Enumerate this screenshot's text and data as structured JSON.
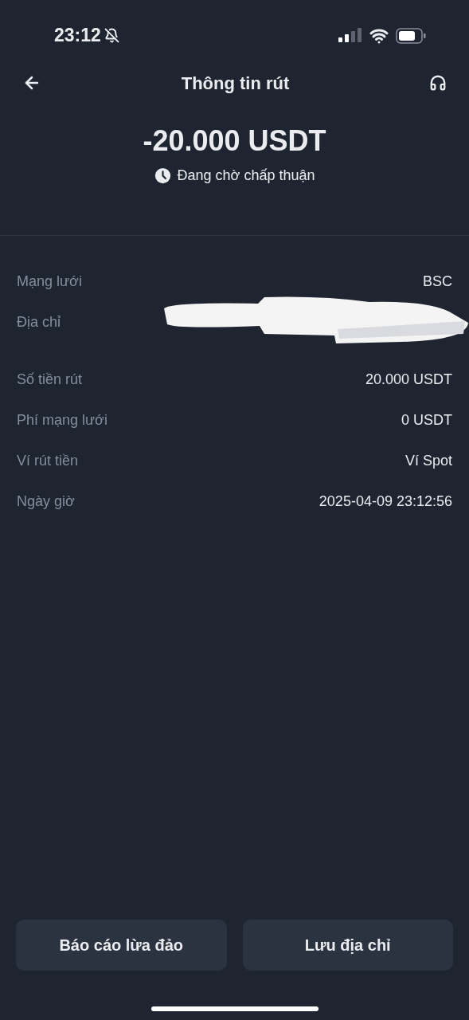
{
  "status_bar": {
    "time": "23:12"
  },
  "header": {
    "title": "Thông tin rút"
  },
  "amount": "-20.000 USDT",
  "status": "Đang chờ chấp thuận",
  "details": [
    {
      "kind": "text",
      "label": "Mạng lưới",
      "value": "BSC"
    },
    {
      "kind": "redacted",
      "label": "Địa chỉ"
    },
    {
      "kind": "text",
      "label": "Số tiền rút",
      "value": "20.000 USDT"
    },
    {
      "kind": "text",
      "label": "Phí mạng lưới",
      "value": "0 USDT"
    },
    {
      "kind": "text",
      "label": "Ví rút tiền",
      "value": "Ví Spot"
    },
    {
      "kind": "text",
      "label": "Ngày giờ",
      "value": "2025-04-09 23:12:56"
    }
  ],
  "buttons": [
    "Báo cáo lừa đảo",
    "Lưu địa chỉ"
  ]
}
